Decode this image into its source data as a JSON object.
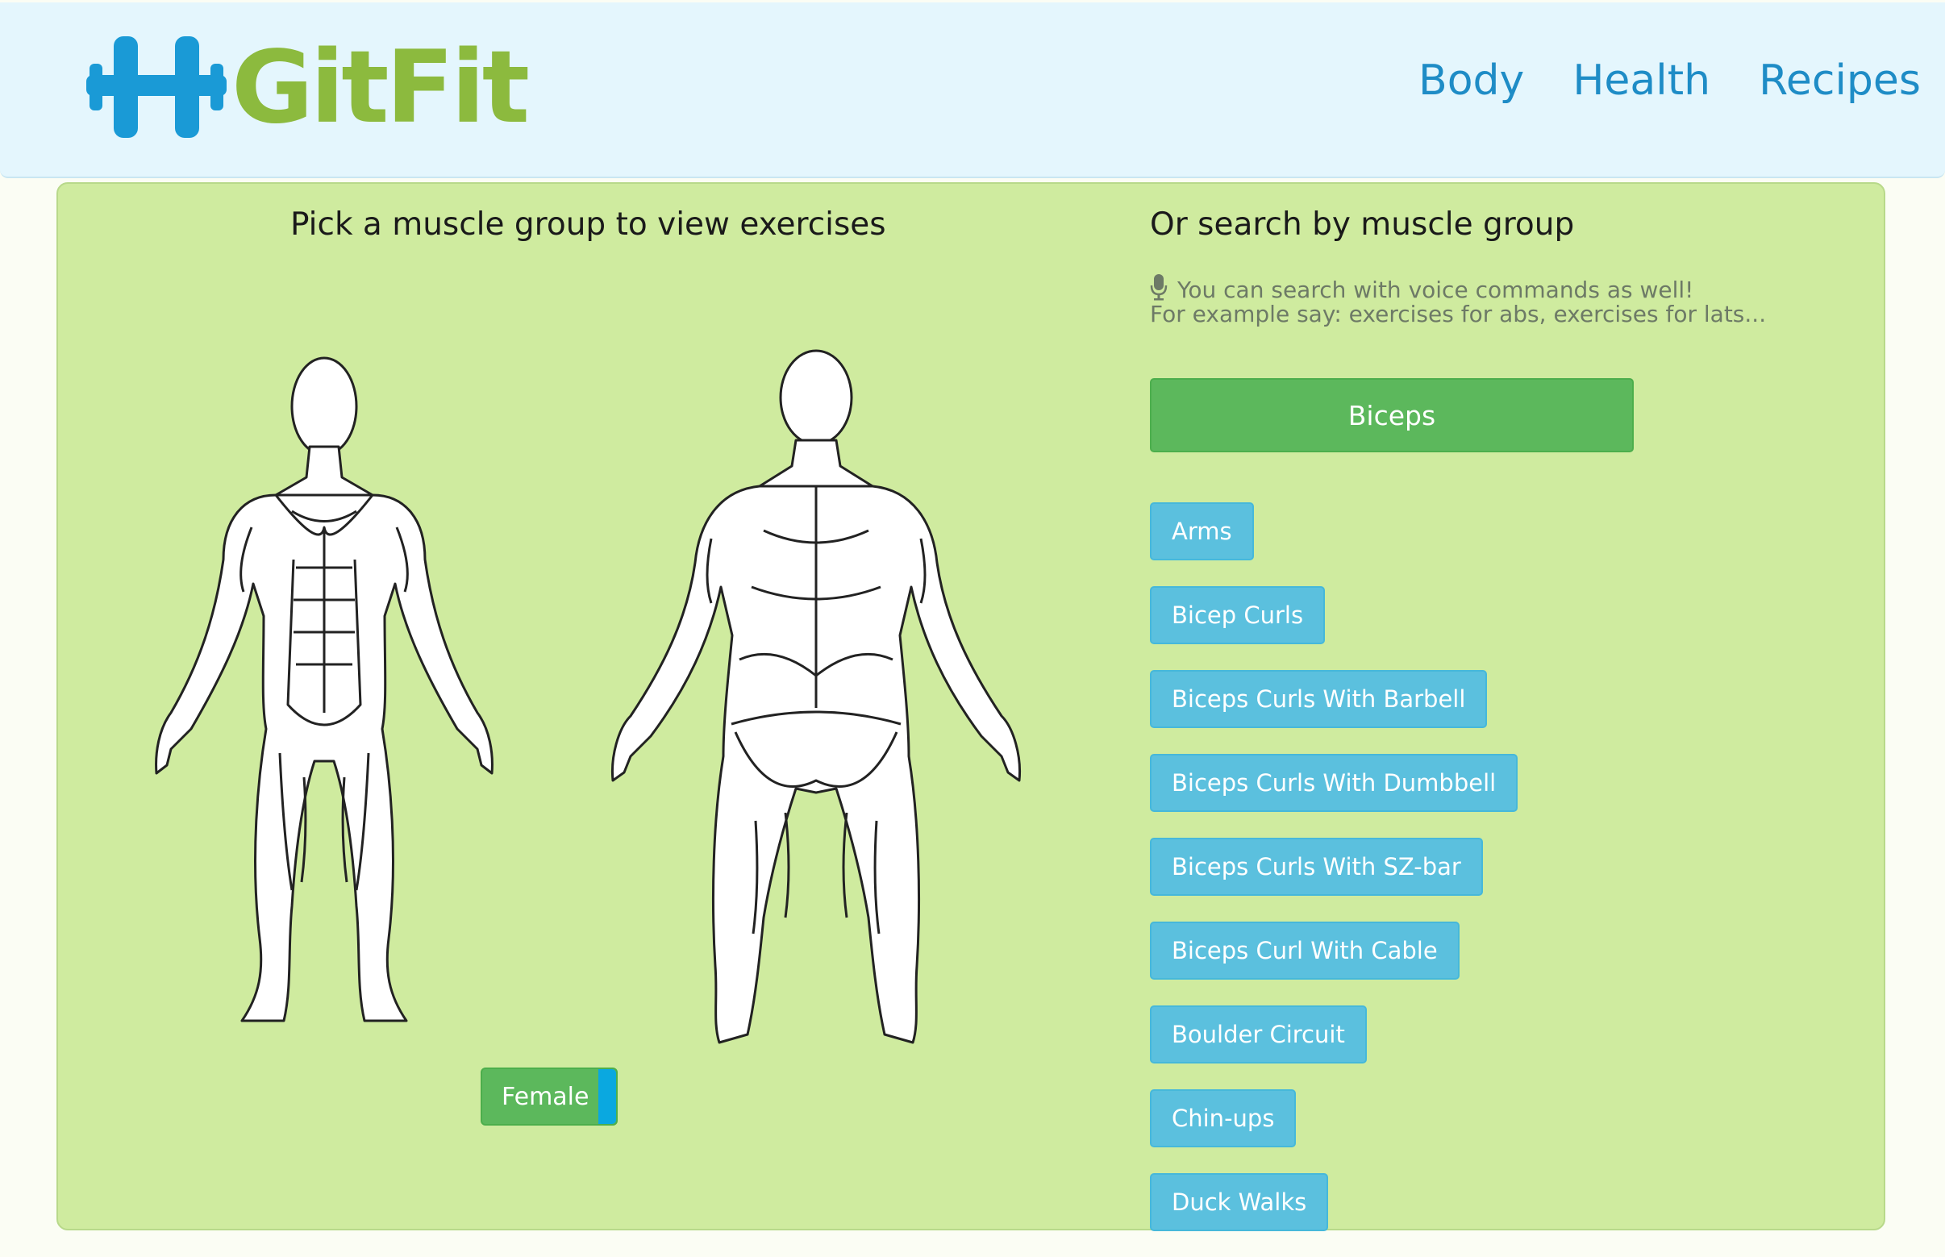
{
  "header": {
    "brand": "GitFit",
    "nav": [
      {
        "label": "Body"
      },
      {
        "label": "Health"
      },
      {
        "label": "Recipes"
      }
    ]
  },
  "left": {
    "title": "Pick a muscle group to view exercises",
    "gender_toggle_label": "Female"
  },
  "right": {
    "title": "Or search by muscle group",
    "voice_hint_line1": "You can search with voice commands as well!",
    "voice_hint_line2": "For example say: exercises for abs, exercises for lats...",
    "selected_group": "Biceps",
    "exercises": [
      "Arms",
      "Bicep Curls",
      "Biceps Curls With Barbell",
      "Biceps Curls With Dumbbell",
      "Biceps Curls With SZ-bar",
      "Biceps Curl With Cable",
      "Boulder Circuit",
      "Chin-ups",
      "Duck Walks"
    ]
  },
  "colors": {
    "navbar_bg": "#e4f6fd",
    "logo_icon": "#1a9ad6",
    "logo_text": "#8cba3e",
    "nav_link": "#1e8cc6",
    "panel_bg": "#cfeb9f",
    "primary_green": "#5cb85c",
    "info_blue": "#5bc0de"
  },
  "icons": [
    "dumbbell-logo-icon",
    "microphone-icon"
  ]
}
